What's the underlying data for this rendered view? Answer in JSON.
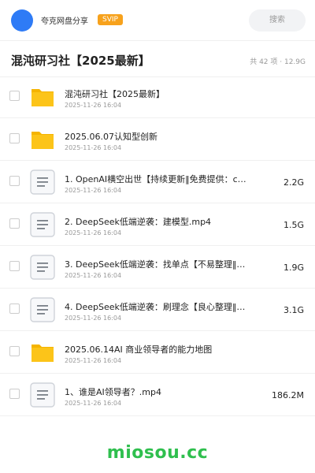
{
  "header": {
    "brand": "夸克网盘分享",
    "badge": "SVIP",
    "search_placeholder": "搜索",
    "avatar_color": "#2e7bf6",
    "badge_color": "#f7a21c"
  },
  "title": {
    "text": "混沌研习社【2025最新】",
    "summary": "共 42 项 · 12.9G"
  },
  "files": [
    {
      "type": "folder",
      "icon": "folder-icon",
      "name": "混沌研习社【2025最新】",
      "date": "2025-11-26 16:04",
      "size": ""
    },
    {
      "type": "folder",
      "icon": "folder-icon",
      "name": "2025.06.07认知型创新",
      "date": "2025-11-26 16:04",
      "size": ""
    },
    {
      "type": "file",
      "icon": "document-icon",
      "name": "1. OpenAI横空出世【持续更新‖免费提供：c…",
      "date": "2025-11-26 16:04",
      "size": "2.2G"
    },
    {
      "type": "file",
      "icon": "document-icon",
      "name": "2. DeepSeek低端逆袭：建模型.mp4",
      "date": "2025-11-26 16:04",
      "size": "1.5G"
    },
    {
      "type": "file",
      "icon": "document-icon",
      "name": "3. DeepSeek低端逆袭：找单点【不易整理‖…",
      "date": "2025-11-26 16:04",
      "size": "1.9G"
    },
    {
      "type": "file",
      "icon": "document-icon",
      "name": "4. DeepSeek低端逆袭：刷理念【良心整理‖…",
      "date": "2025-11-26 16:04",
      "size": "3.1G"
    },
    {
      "type": "folder",
      "icon": "folder-icon",
      "name": "2025.06.14AI 商业领导者的能力地图",
      "date": "2025-11-26 16:04",
      "size": ""
    },
    {
      "type": "file",
      "icon": "document-icon",
      "name": "1、谁是AI领导者？.mp4",
      "date": "2025-11-26 16:04",
      "size": "186.2M"
    }
  ],
  "watermark": "miosou.cc",
  "colors": {
    "folder": "#fcc419",
    "folder_tab": "#f5b400",
    "doc_border": "#cfd3d9",
    "watermark": "#2fbf4e"
  }
}
